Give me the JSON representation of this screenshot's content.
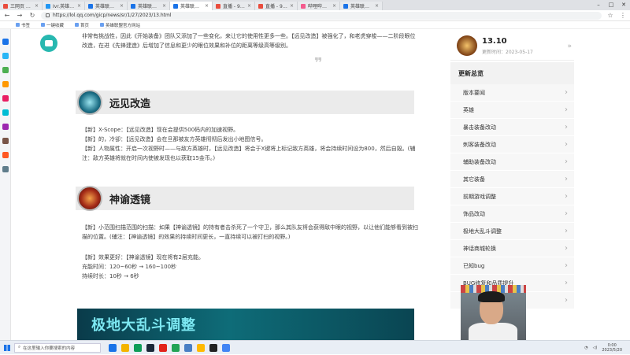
{
  "browser": {
    "tabs": [
      {
        "label": "三网页 - 标站上之下载",
        "color": "#e94c3d",
        "active": false
      },
      {
        "label": "Ivr.英雄联盟",
        "color": "#2196f3",
        "active": false
      },
      {
        "label": "英雄联盟官方网站 腾讯",
        "color": "#1a73e8",
        "active": false
      },
      {
        "label": "英雄联盟官方网站 腾讯",
        "color": "#1a73e8",
        "active": false
      },
      {
        "label": "英雄联盟 英雄联盟官方网站",
        "color": "#1a73e8",
        "active": true
      },
      {
        "label": "直播 - 9000 点赞福利 - 百",
        "color": "#e94c3d",
        "active": false
      },
      {
        "label": "直播 - 9000 点赞福利",
        "color": "#e94c3d",
        "active": false
      },
      {
        "label": "哔哩哔哩 - 7040",
        "color": "#f45a8d",
        "active": false
      },
      {
        "label": "英雄联盟2023赛季前瞻",
        "color": "#1a73e8",
        "active": false
      }
    ],
    "url": "https://lol.qq.com/gicp/news/sr/1/27/2023/13.html",
    "bookmarks": [
      "书签",
      "一键收藏",
      "首页",
      "英雄联盟官方网站"
    ]
  },
  "sidebar_left_colors": [
    "#1a73e8",
    "#29b6f6",
    "#4caf50",
    "#ff9800",
    "#e91e63",
    "#00bcd4",
    "#9c27b0",
    "#795548",
    "#ff5722",
    "#607d8b"
  ],
  "article": {
    "intro": "非常有挑战性，因此《开始装备》团队又添加了一些变化，来让它的使用性更多一些。【远见改造】被强化了，和老虎穿梭——二阶段眼位改造，在进《先锋建造》后增加了信息和更少的眼位效果和补位的距离等级高等级别。",
    "sections": [
      {
        "title": "远见改造",
        "paragraphs": [
          "【新】X-Scope：【远见改造】现在会提供500码内的加速视野。",
          "【新】的，冷卻：【远见改造】会在旦那被友方英雄彻彻后发出小地图信号。",
          "【新】人物属性：开启一次视野时——与敌方英雄时，【远见改造】将会于X键将上标记敌方英雄，将会持续时间设为800，然后自毁。(辅注：敌方英雄将就在时间内使被发现也以获取15金币。)"
        ]
      },
      {
        "title": "神谕透镜",
        "paragraphs": [
          "【新】小范围扫描范围的扫描：如果【神谕透镜】的持有者击杀死了一个守卫，那么其队友将会获得敌中眼的视野，以让他们能够看到被扫描的位置。(辅注：【神谕透镜】的效果的持续时间更长，一直持续可以被打扫的视野。)",
          "【新】效果更好：【神谕透镜】现在将有2层充能。",
          "充能时间：120~60秒 → 160~100秒",
          "持续时长：10秒 → 6秒"
        ]
      }
    ],
    "banner": "极地大乱斗调整"
  },
  "right_sidebar": {
    "version": "13.10",
    "date": "更新时间：2023-05-17",
    "summary_title": "更新总览",
    "menu": [
      "版本要闻",
      "英雄",
      "暴击装备改动",
      "刺客装备改动",
      "辅助装备改动",
      "其它装备",
      "前期游戏调整",
      "饰品改动",
      "极地大乱斗调整",
      "神话商城轮换",
      "已知bug",
      "BUG修复和品质提升",
      ""
    ]
  },
  "taskbar": {
    "search_placeholder": "在这里输入你要搜索的内容",
    "app_colors": [
      "#1a73e8",
      "#f4b400",
      "#0f9d58",
      "#1b2838",
      "#e2231a",
      "#23a455",
      "#4a7fc4",
      "#ffb900",
      "#222222",
      "#4285f4"
    ],
    "time": "0:00",
    "date": "2023/5/20"
  }
}
